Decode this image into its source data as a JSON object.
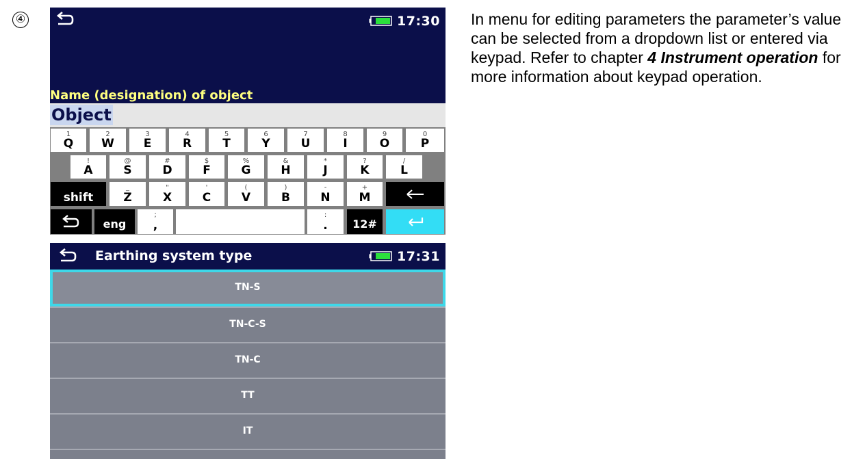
{
  "step_marker": "④",
  "screen1": {
    "time": "17:30",
    "field_label": "Name (designation) of object",
    "field_value": "Object",
    "keys": {
      "row1": [
        {
          "sub": "1",
          "main": "Q"
        },
        {
          "sub": "2",
          "main": "W"
        },
        {
          "sub": "3",
          "main": "E"
        },
        {
          "sub": "4",
          "main": "R"
        },
        {
          "sub": "5",
          "main": "T"
        },
        {
          "sub": "6",
          "main": "Y"
        },
        {
          "sub": "7",
          "main": "U"
        },
        {
          "sub": "8",
          "main": "I"
        },
        {
          "sub": "9",
          "main": "O"
        },
        {
          "sub": "0",
          "main": "P"
        }
      ],
      "row2": [
        {
          "sub": "!",
          "main": "A"
        },
        {
          "sub": "@",
          "main": "S"
        },
        {
          "sub": "#",
          "main": "D"
        },
        {
          "sub": "$",
          "main": "F"
        },
        {
          "sub": "%",
          "main": "G"
        },
        {
          "sub": "&",
          "main": "H"
        },
        {
          "sub": "*",
          "main": "J"
        },
        {
          "sub": "?",
          "main": "K"
        },
        {
          "sub": "/",
          "main": "L"
        }
      ],
      "row3": [
        {
          "sub": "_",
          "main": "Z"
        },
        {
          "sub": "\"",
          "main": "X"
        },
        {
          "sub": "'",
          "main": "C"
        },
        {
          "sub": "(",
          "main": "V"
        },
        {
          "sub": ")",
          "main": "B"
        },
        {
          "sub": "-",
          "main": "N"
        },
        {
          "sub": "+",
          "main": "M"
        }
      ],
      "shift": "shift",
      "lang": "eng",
      "comma_sub": ";",
      "comma": ",",
      "period_sub": ":",
      "period": ".",
      "symbols": "12#"
    }
  },
  "screen2": {
    "title": "Earthing system type",
    "time": "17:31",
    "options": [
      "TN-S",
      "TN-C-S",
      "TN-C",
      "TT",
      "IT"
    ],
    "selected_index": 0
  },
  "description": {
    "text1": "In menu for editing parameters the parameter’s value can be selected from a dropdown list or entered via keypad. Refer to chapter ",
    "chapter_ref": "4 Instrument operation",
    "text2": " for more information about keypad operation."
  },
  "colors": {
    "header_bg": "#0b0f4a",
    "label_yellow": "#ffff80",
    "accent_cyan": "#33ddf5",
    "option_bg": "#7c808c"
  }
}
